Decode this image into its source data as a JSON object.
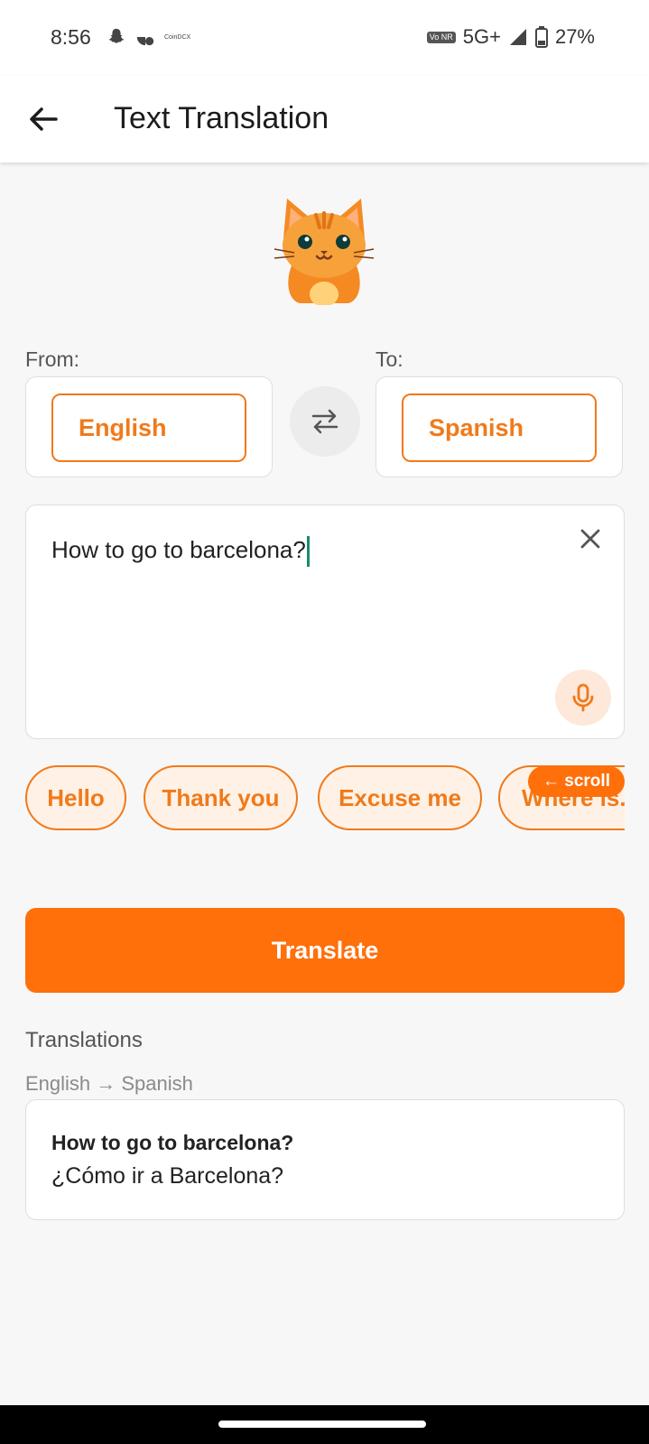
{
  "status_bar": {
    "time": "8:56",
    "network": "5G+",
    "vonr": "Vo NR",
    "battery": "27%"
  },
  "app_bar": {
    "title": "Text Translation"
  },
  "languages": {
    "from_label": "From:",
    "to_label": "To:",
    "from": "English",
    "to": "Spanish"
  },
  "input": {
    "value": "How to go to barcelona?"
  },
  "chips": [
    "Hello",
    "Thank you",
    "Excuse me",
    "Where is..."
  ],
  "scroll_hint": "← scroll",
  "translate_button": "Translate",
  "translations": {
    "section_title": "Translations",
    "pair_label": "English → Spanish",
    "items": [
      {
        "source": "How to go to barcelona?",
        "target": "¿Cómo ir a Barcelona?"
      }
    ]
  },
  "colors": {
    "accent": "#ff6f0a",
    "chip_border": "#f07a1b",
    "chip_bg": "#fff1e5",
    "background": "#f7f7f7"
  },
  "icons": {
    "back": "arrow-left-icon",
    "swap": "swap-arrows-icon",
    "clear": "close-icon",
    "mic": "microphone-icon",
    "mascot": "cat-mascot"
  }
}
